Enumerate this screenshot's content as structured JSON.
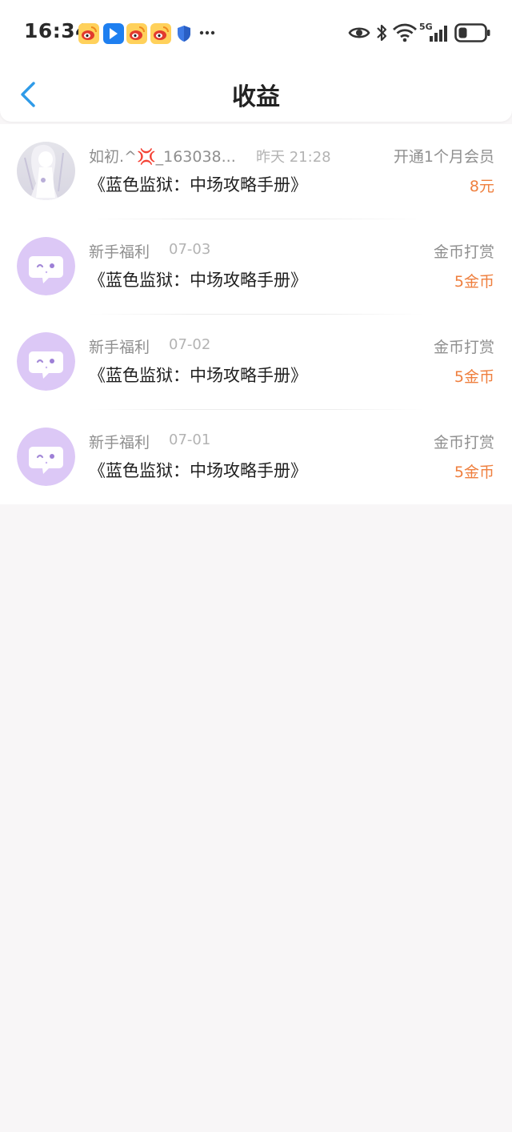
{
  "status_bar": {
    "time": "16:34",
    "network": "5G",
    "icons": [
      "weibo-icon",
      "app-icon",
      "weibo-icon",
      "weibo-icon",
      "shield-icon",
      "more-icon",
      "eye-icon",
      "bluetooth-icon",
      "wifi-icon",
      "signal-icon",
      "battery-icon"
    ]
  },
  "header": {
    "title": "收益",
    "back_icon": "chevron-left-icon"
  },
  "records": [
    {
      "user": "如初.^💢_163038...",
      "date": "昨天 21:28",
      "book": "《蓝色监狱：中场攻略手册》",
      "type": "开通1个月会员",
      "amount": "8元",
      "avatar": "photo-avatar"
    },
    {
      "user": "新手福利",
      "date": "07-03",
      "book": "《蓝色监狱：中场攻略手册》",
      "type": "金币打赏",
      "amount": "5金币",
      "avatar": "chat-bubble-avatar"
    },
    {
      "user": "新手福利",
      "date": "07-02",
      "book": "《蓝色监狱：中场攻略手册》",
      "type": "金币打赏",
      "amount": "5金币",
      "avatar": "chat-bubble-avatar"
    },
    {
      "user": "新手福利",
      "date": "07-01",
      "book": "《蓝色监狱：中场攻略手册》",
      "type": "金币打赏",
      "amount": "5金币",
      "avatar": "chat-bubble-avatar"
    }
  ],
  "colors": {
    "accent_blue": "#2f9be8",
    "amount_orange": "#ef7f3e",
    "avatar_purple": "#dcc8f6"
  }
}
